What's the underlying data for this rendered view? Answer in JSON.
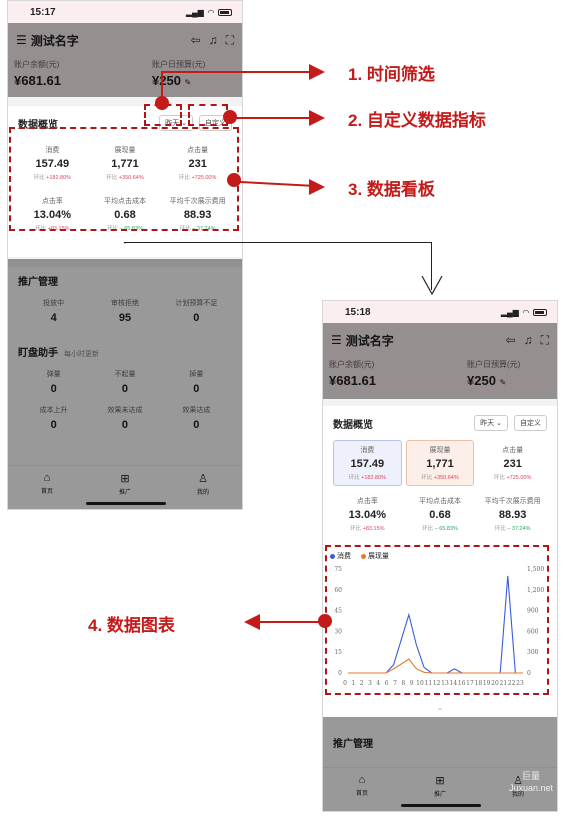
{
  "status": {
    "time1": "15:17",
    "time2": "15:18"
  },
  "header": {
    "title": "测试名字"
  },
  "account": {
    "balance_label": "账户余额(元)",
    "balance_value": "¥681.61",
    "budget_label": "账户日预算(元)",
    "budget_value": "¥250"
  },
  "overview": {
    "title": "数据概览",
    "date_filter": "昨天",
    "custom": "自定义",
    "metrics": [
      {
        "label": "消费",
        "value": "157.49",
        "chg_prefix": "环比",
        "chg": "+182.80%",
        "dir": "up"
      },
      {
        "label": "展现量",
        "value": "1,771",
        "chg_prefix": "环比",
        "chg": "+350.64%",
        "dir": "up"
      },
      {
        "label": "点击量",
        "value": "231",
        "chg_prefix": "环比",
        "chg": "+725.00%",
        "dir": "up"
      },
      {
        "label": "点击率",
        "value": "13.04%",
        "chg_prefix": "环比",
        "chg": "+83.15%",
        "dir": "up"
      },
      {
        "label": "平均点击成本",
        "value": "0.68",
        "chg_prefix": "环比",
        "chg": "– 65.83%",
        "dir": "down"
      },
      {
        "label": "平均千次展示费用",
        "value": "88.93",
        "chg_prefix": "环比",
        "chg": "– 37.24%",
        "dir": "down"
      }
    ]
  },
  "promo": {
    "title": "推广管理",
    "items": [
      {
        "label": "投放中",
        "value": "4"
      },
      {
        "label": "审核拒绝",
        "value": "95"
      },
      {
        "label": "计划预算不足",
        "value": "0"
      }
    ]
  },
  "monitor": {
    "title": "盯盘助手",
    "subtitle": "每小时更新",
    "items": [
      {
        "label": "弹量",
        "value": "0"
      },
      {
        "label": "不起量",
        "value": "0"
      },
      {
        "label": "掉量",
        "value": "0"
      },
      {
        "label": "成本上升",
        "value": "0"
      },
      {
        "label": "效果未达成",
        "value": "0"
      },
      {
        "label": "效果达成",
        "value": "0"
      }
    ]
  },
  "tabbar": {
    "home": "首页",
    "promo": "推广",
    "mine": "我的"
  },
  "annotations": {
    "a1": "1. 时间筛选",
    "a2": "2. 自定义数据指标",
    "a3": "3. 数据看板",
    "a4": "4. 数据图表"
  },
  "watermark": {
    "line1": "巨量",
    "line2": "Juxuan.net"
  },
  "chart_data": {
    "type": "line",
    "x": [
      0,
      1,
      2,
      3,
      4,
      5,
      6,
      7,
      8,
      9,
      10,
      11,
      12,
      13,
      14,
      15,
      16,
      17,
      18,
      19,
      20,
      21,
      22,
      23
    ],
    "x_tick_labels": [
      "0",
      "1",
      "2",
      "3",
      "4",
      "6",
      "7",
      "8",
      "9",
      "10",
      "11",
      "12",
      "13",
      "14",
      "16",
      "17",
      "18",
      "19",
      "20",
      "21",
      "22",
      "23"
    ],
    "series": [
      {
        "name": "消费",
        "color": "#3b5bdb",
        "axis": "left",
        "values": [
          0,
          0,
          0,
          0,
          0,
          0,
          6,
          24,
          42,
          20,
          4,
          0,
          0,
          0,
          3,
          0,
          0,
          0,
          0,
          0,
          0,
          70,
          0,
          0
        ]
      },
      {
        "name": "展现量",
        "color": "#e8772e",
        "axis": "right",
        "values": [
          0,
          0,
          0,
          0,
          0,
          0,
          60,
          130,
          200,
          60,
          10,
          0,
          0,
          0,
          0,
          0,
          0,
          0,
          0,
          0,
          0,
          0,
          0,
          0
        ]
      }
    ],
    "y_left_ticks": [
      "0",
      "15",
      "30",
      "45",
      "60",
      "75"
    ],
    "y_left_range": [
      0,
      75
    ],
    "y_right_ticks": [
      "0",
      "300",
      "600",
      "900",
      "1,200",
      "1,500"
    ],
    "y_right_range": [
      0,
      1500
    ],
    "grid": false,
    "legend": "top-left"
  }
}
